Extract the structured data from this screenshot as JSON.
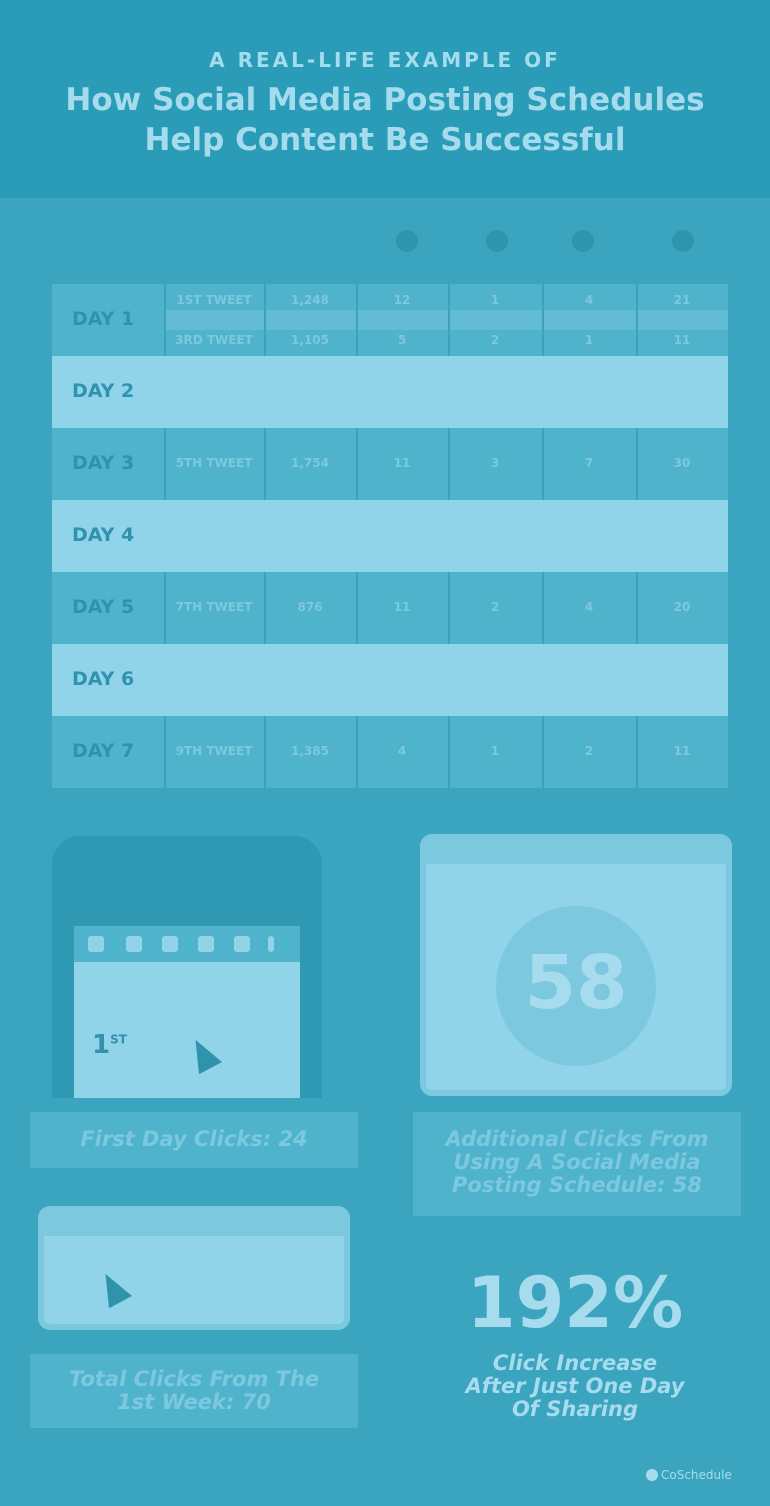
{
  "header": {
    "eyebrow": "A REAL-LIFE EXAMPLE OF",
    "title_line1": "How Social Media Posting Schedules",
    "title_line2": "Help Content Be Successful"
  },
  "table": {
    "day1": {
      "label": "DAY 1",
      "rows": [
        [
          "1ST TWEET",
          "1,248",
          "12",
          "1",
          "4",
          "21"
        ],
        [
          "3RD TWEET",
          "1,105",
          "5",
          "2",
          "1",
          "11"
        ]
      ]
    },
    "day2": {
      "label": "DAY 2"
    },
    "day3": {
      "label": "DAY 3",
      "cells": [
        "5TH TWEET",
        "1,754",
        "11",
        "3",
        "7",
        "30"
      ]
    },
    "day4": {
      "label": "DAY 4"
    },
    "day5": {
      "label": "DAY 5",
      "cells": [
        "7TH TWEET",
        "876",
        "11",
        "2",
        "4",
        "20"
      ]
    },
    "day6": {
      "label": "DAY 6"
    },
    "day7": {
      "label": "DAY 7",
      "cells": [
        "9TH TWEET",
        "1,385",
        "4",
        "1",
        "2",
        "11"
      ]
    }
  },
  "phone": {
    "badge": "1",
    "badge_sup": "ST"
  },
  "dial": {
    "value": "58"
  },
  "captions": {
    "first_day": "First Day Clicks: 24",
    "additional_line1": "Additional Clicks From",
    "additional_line2": "Using A Social Media",
    "additional_line3": "Posting Schedule: 58",
    "total_line1": "Total Clicks From The",
    "total_line2": "1st Week: 70"
  },
  "increase": {
    "value": "192%",
    "line1": "Click Increase",
    "line2": "After Just One Day",
    "line3": "Of Sharing"
  },
  "logo": {
    "text": "CoSchedule"
  },
  "icons": [
    "pencil-icon",
    "chat-icon",
    "heart-icon",
    "bubble-icon"
  ]
}
